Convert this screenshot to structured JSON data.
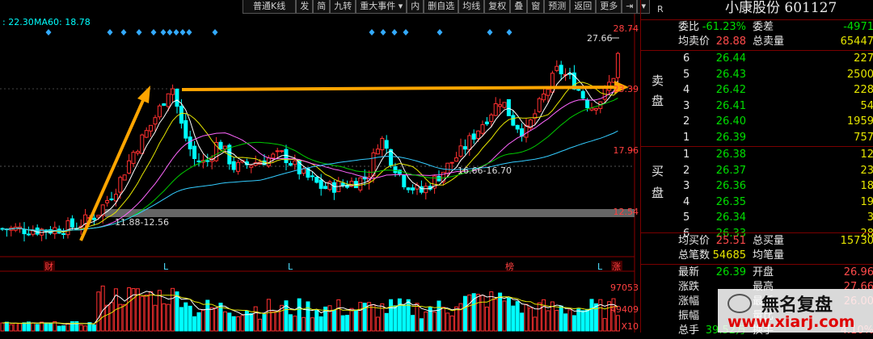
{
  "header": {
    "ma_left": ": 22.30",
    "ma60": "MA60: 18.78"
  },
  "toolbar": [
    "普通K线",
    "发",
    "简",
    "九转",
    "重大事件",
    "内",
    "删自选",
    "均线",
    "复权",
    "叠",
    "窗",
    "预测",
    "返回",
    "更多"
  ],
  "price_labels": [
    "28.74",
    "23.39",
    "17.96",
    "12.54"
  ],
  "volume_labels": [
    "97053",
    "49409",
    "X10"
  ],
  "chart_annotations": {
    "high_label": "27.66",
    "range_low": "11.88-12.56",
    "range_mid": "16.66-16.70",
    "markers": [
      "财",
      "L",
      "L",
      "榜",
      "L",
      "涨"
    ]
  },
  "panel": {
    "corner": "R",
    "title": "小康股份 601127",
    "weibi": {
      "label": "委比",
      "val": "-61.23%",
      "label2": "委差",
      "val2": "-4971"
    },
    "avg_sell": {
      "label": "均卖价",
      "val": "28.88",
      "label2": "总卖量",
      "val2": "65447"
    },
    "sell_side": "卖盘",
    "sell": [
      {
        "lv": "6",
        "price": "26.44",
        "vol": "227"
      },
      {
        "lv": "5",
        "price": "26.43",
        "vol": "2500"
      },
      {
        "lv": "4",
        "price": "26.42",
        "vol": "228"
      },
      {
        "lv": "3",
        "price": "26.41",
        "vol": "54"
      },
      {
        "lv": "2",
        "price": "26.40",
        "vol": "1959"
      },
      {
        "lv": "1",
        "price": "26.39",
        "vol": "757"
      }
    ],
    "buy_side": "买盘",
    "buy": [
      {
        "lv": "1",
        "price": "26.38",
        "vol": "12"
      },
      {
        "lv": "2",
        "price": "26.37",
        "vol": "23"
      },
      {
        "lv": "3",
        "price": "26.36",
        "vol": "18"
      },
      {
        "lv": "4",
        "price": "26.35",
        "vol": "19"
      },
      {
        "lv": "5",
        "price": "26.34",
        "vol": "3"
      },
      {
        "lv": "6",
        "price": "26.33",
        "vol": "28"
      }
    ],
    "avg_buy": {
      "label": "均买价",
      "val": "25.51",
      "label2": "总买量",
      "val2": "15730"
    },
    "total_trades": {
      "label": "总笔数",
      "val": "54685",
      "label2": "均笔量",
      "val2": ""
    },
    "stats": [
      {
        "label": "最新",
        "val": "26.39",
        "label2": "开盘",
        "val2": "26.96"
      },
      {
        "label": "涨跌",
        "val": "",
        "label2": "最高",
        "val2": "27.66"
      },
      {
        "label": "涨幅",
        "val": "",
        "label2": "最低",
        "val2": "26.00"
      },
      {
        "label": "振幅",
        "val": "",
        "label2": "量比",
        "val2": ""
      },
      {
        "label": "总手",
        "val": "39.52万",
        "label2": "换手",
        "val2": "4.10%"
      }
    ]
  },
  "watermark": {
    "name": "無名复盘",
    "url": "www.xiarj.com"
  },
  "colors": {
    "up": "#ff3030",
    "down": "#00ffff",
    "ma5": "#ffffff",
    "ma10": "#e6e600",
    "ma20": "#ff66ff",
    "ma30": "#00cc00",
    "ma60": "#33ccff",
    "arrow": "#ffa500"
  }
}
